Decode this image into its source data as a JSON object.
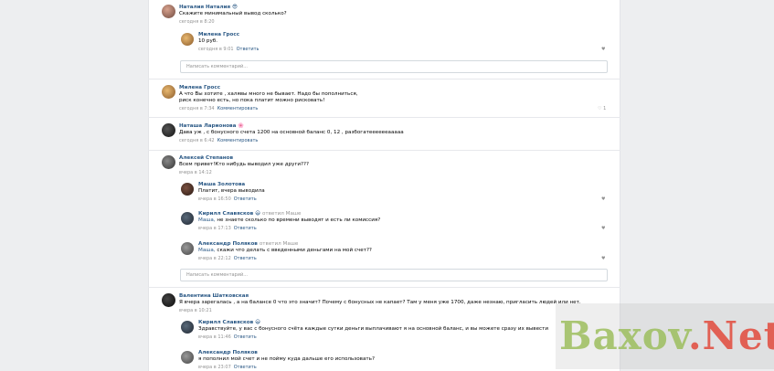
{
  "comments": [
    {
      "author": "Наталия Наталия 😎",
      "text": "Скажите минимальный вывод сколько?",
      "time": "сегодня в 8:20",
      "replies": [
        {
          "author": "Милена Гросс",
          "text": "10 руб.",
          "time": "сегодня в 9:01",
          "action": "Ответить",
          "like": "♥"
        }
      ],
      "input_placeholder": "Написать комментарий..."
    },
    {
      "author": "Милена Гросс",
      "text_lines": [
        "А что Вы хотите , халявы много не бывает. Надо бы пополниться,",
        "риск конечно есть, но пока платит можно рисковать!"
      ],
      "time": "сегодня в 7:34",
      "action": "Комментировать",
      "like": "♡ 1"
    },
    {
      "author": "Наташа Ларионова 🌸",
      "text": "Дава уж , с бонусного счета 1200 на основной баланс 0, 12 , разбогатееееееааааа",
      "time": "сегодня в 6:42",
      "action": "Комментировать"
    },
    {
      "author": "Алексей Степанов",
      "text": "Всем привет!Кто нибудь выводил уже други???",
      "time": "вчера в 14:12",
      "replies": [
        {
          "author": "Маша Золотова",
          "text": "Платит, вчера выводила",
          "time": "вчера в 16:50",
          "action": "Ответить",
          "like": "♥"
        },
        {
          "author": "Кирилл Славясков 😃",
          "reply_to": "ответил Маше",
          "mention": "Маша,",
          "text": " не знаете сколько по времени выводят и есть ли комиссия?",
          "time": "вчера в 17:13",
          "action": "Ответить",
          "like": "♥"
        },
        {
          "author": "Александр Поляков",
          "reply_to": "ответил Маше",
          "mention": "Маша,",
          "text": " скажи что делать с введенными деньгами на мой счет??",
          "time": "вчера в 22:12",
          "action": "Ответить",
          "like": "♥"
        }
      ],
      "input_placeholder": "Написать комментарий..."
    },
    {
      "author": "Валентина Шатковская",
      "text": "Я вчера зарегалась , а на балансе 0 что это значит? Почему с бонусных не капает? Там у меня уже 1700, даже незнаю, пригласить людей или нет.",
      "time": "вчера в 10:21",
      "replies": [
        {
          "author": "Кирилл Славясков 😃",
          "text": "Здравствуйте, у вас с бонусного счёта каждые сутки деньги выплачивают я на основной баланс, и вы можете сразу их вывести",
          "time": "вчера в 11:46",
          "action": "Ответить"
        },
        {
          "author": "Александр Поляков",
          "text": "я пополнил мой счет и не пойму куда дальше его использовать?",
          "time": "вчера в 23:07",
          "action": "Ответить"
        }
      ]
    }
  ],
  "watermark": {
    "part1": "Baxov",
    "dot": ".",
    "part2": "Net"
  }
}
